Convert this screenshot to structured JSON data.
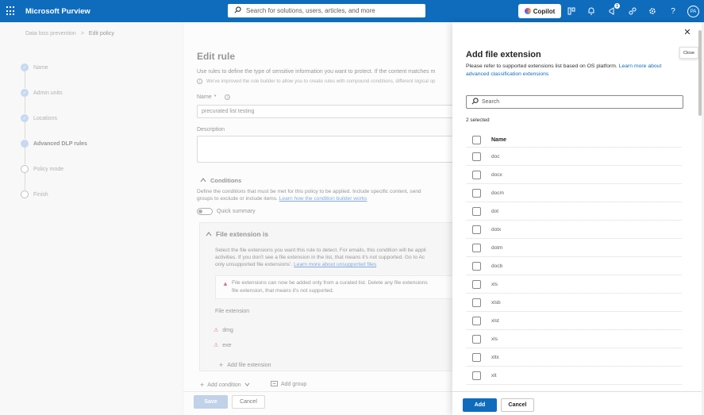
{
  "topbar": {
    "app_title": "Microsoft Purview",
    "search_placeholder": "Search for solutions, users, articles, and more",
    "copilot_label": "Copilot",
    "notification_count": "1",
    "avatar_initials": "PA"
  },
  "breadcrumb": {
    "root": "Data loss prevention",
    "current": "Edit policy"
  },
  "steps": [
    {
      "label": "Name",
      "state": "done"
    },
    {
      "label": "Admin units",
      "state": "done"
    },
    {
      "label": "Locations",
      "state": "done"
    },
    {
      "label": "Advanced DLP rules",
      "state": "current"
    },
    {
      "label": "Policy mode",
      "state": "todo"
    },
    {
      "label": "Finish",
      "state": "todo"
    }
  ],
  "main": {
    "title": "Edit rule",
    "desc": "Use rules to define the type of sensitive information you want to protect. If the content matches m",
    "info": "We've improved the rule builder to allow you to create rules with compound conditions, different logical op",
    "name_label": "Name",
    "name_required": "*",
    "name_value": "precurated list testing",
    "desc_label": "Description",
    "conditions_title": "Conditions",
    "conditions_desc_1": "Define the conditions that must be met for this policy to be applied. Include specific content, send",
    "conditions_desc_2": "groups to exclude or include items.",
    "conditions_link": "Learn how the condition builder works",
    "quick_summary": "Quick summary",
    "fe_title": "File extension is",
    "fe_desc_1": "Select the file extensions you want this rule to detect. For emails, this condition will be appli",
    "fe_desc_2": "activities. If you don't see a file extension in the list, that means it's not supported. Go to Ac",
    "fe_desc_3": "only unsupported file extensions'.",
    "fe_link": "Learn more about unsupported files",
    "warn_1": "File extensions can now be added only from a curated list. Delete any file extensions",
    "warn_2": "file extension, that means it's not supported.",
    "fe_label": "File extension",
    "fe_items": [
      "dmg",
      "exe"
    ],
    "add_fe": "Add file extension",
    "add_condition": "Add condition",
    "add_group": "Add group",
    "save": "Save",
    "cancel": "Cancel"
  },
  "panel": {
    "title": "Add file extension",
    "desc": "Please refer to supported extensions list based on OS platform.",
    "desc_link": "Learn more about advanced classification extensions",
    "search_placeholder": "Search",
    "selected_count": "2 selected",
    "column_name": "Name",
    "extensions": [
      "doc",
      "docx",
      "docm",
      "dot",
      "dotx",
      "dotm",
      "docb",
      "xls",
      "xlsb",
      "xlst",
      "xls",
      "xltx",
      "xlt"
    ],
    "add": "Add",
    "cancel": "Cancel",
    "close_tooltip": "Close"
  }
}
